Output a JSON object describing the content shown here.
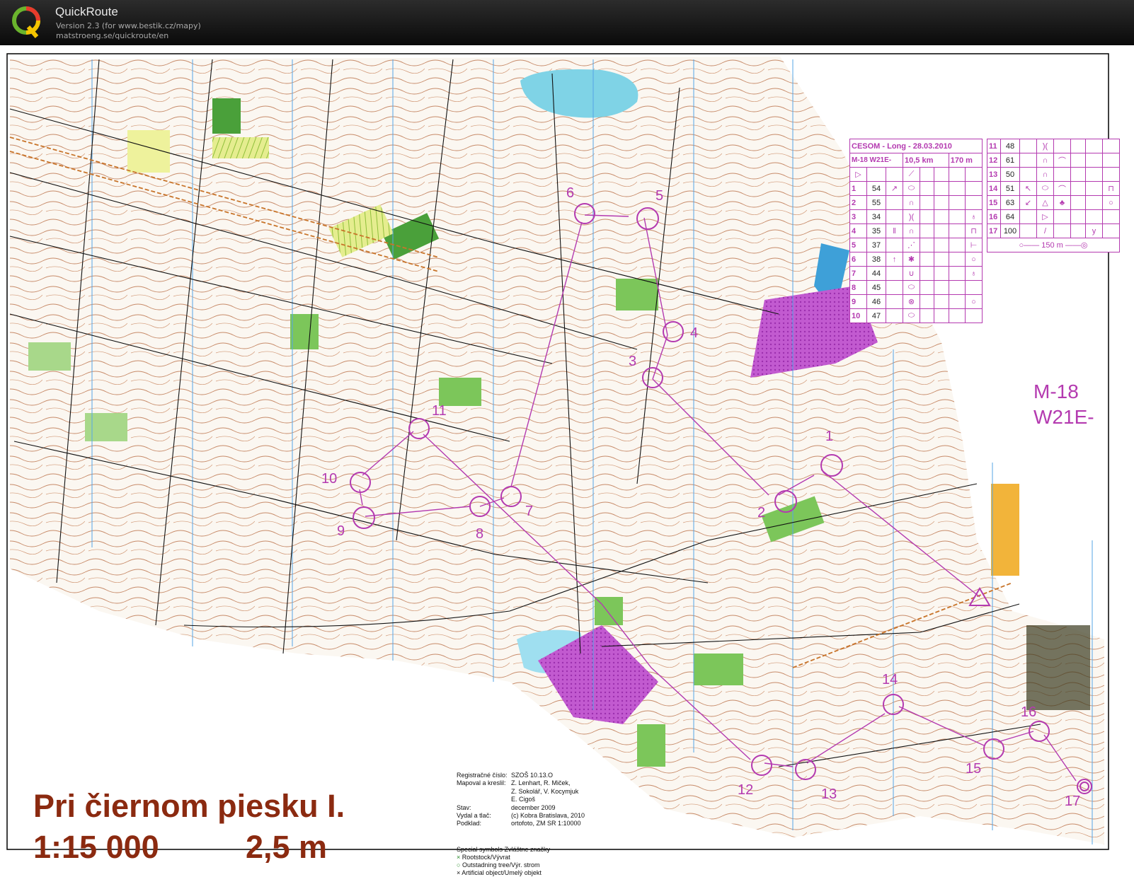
{
  "app": {
    "name": "QuickRoute",
    "version": "Version 2.3  (for www.bestik.cz/mapy)",
    "url": "matstroeng.se/quickroute/en"
  },
  "map": {
    "title": "Pri čiernom piesku I.",
    "scale": "1:15 000",
    "equidistance": "2,5 m",
    "course_label": "M-18",
    "course_label2": "W21E-",
    "controls": [
      "1",
      "2",
      "3",
      "4",
      "5",
      "6",
      "7",
      "8",
      "9",
      "10",
      "11",
      "12",
      "13",
      "14",
      "15",
      "16",
      "17"
    ],
    "info": [
      {
        "k": "Registračné číslo:",
        "v": "SZOŠ 10.13.O"
      },
      {
        "k": "Mapoval a kreslil:",
        "v": "Z. Lenhart, R. Miček,"
      },
      {
        "k": "",
        "v": "Z. Sokolář, V. Kocymjuk"
      },
      {
        "k": "",
        "v": "E. Cigoš"
      },
      {
        "k": "Stav:",
        "v": "december 2009"
      },
      {
        "k": "Vydal a tlač:",
        "v": "(c) Kobra Bratislava, 2010"
      },
      {
        "k": "Podklad:",
        "v": "ortofoto, ZM SR 1:10000"
      }
    ],
    "symbols_title": "Special symbols    Zvláštne značky",
    "symbols": [
      "Rootstock/Vývrat",
      "Outstadning tree/Výr. strom",
      "Artificial object/Umelý objekt"
    ]
  },
  "description": {
    "event": "CESOM - Long - 28.03.2010",
    "class": "M-18 W21E-",
    "length": "10,5 km",
    "climb": "170 m",
    "rows": [
      {
        "n": "1",
        "code": "54"
      },
      {
        "n": "2",
        "code": "55"
      },
      {
        "n": "3",
        "code": "34"
      },
      {
        "n": "4",
        "code": "35"
      },
      {
        "n": "5",
        "code": "37"
      },
      {
        "n": "6",
        "code": "38"
      },
      {
        "n": "7",
        "code": "44"
      },
      {
        "n": "8",
        "code": "45"
      },
      {
        "n": "9",
        "code": "46"
      },
      {
        "n": "10",
        "code": "47"
      }
    ],
    "rows2": [
      {
        "n": "11",
        "code": "48"
      },
      {
        "n": "12",
        "code": "61"
      },
      {
        "n": "13",
        "code": "50"
      },
      {
        "n": "14",
        "code": "51"
      },
      {
        "n": "15",
        "code": "63"
      },
      {
        "n": "16",
        "code": "64"
      },
      {
        "n": "17",
        "code": "100"
      }
    ],
    "finish_distance": "150 m"
  },
  "colors": {
    "course": "#b43ab0",
    "contour": "#a0522d",
    "green": "#6cbf4a",
    "water": "#7fd3e6",
    "olive": "#8b2a10"
  }
}
